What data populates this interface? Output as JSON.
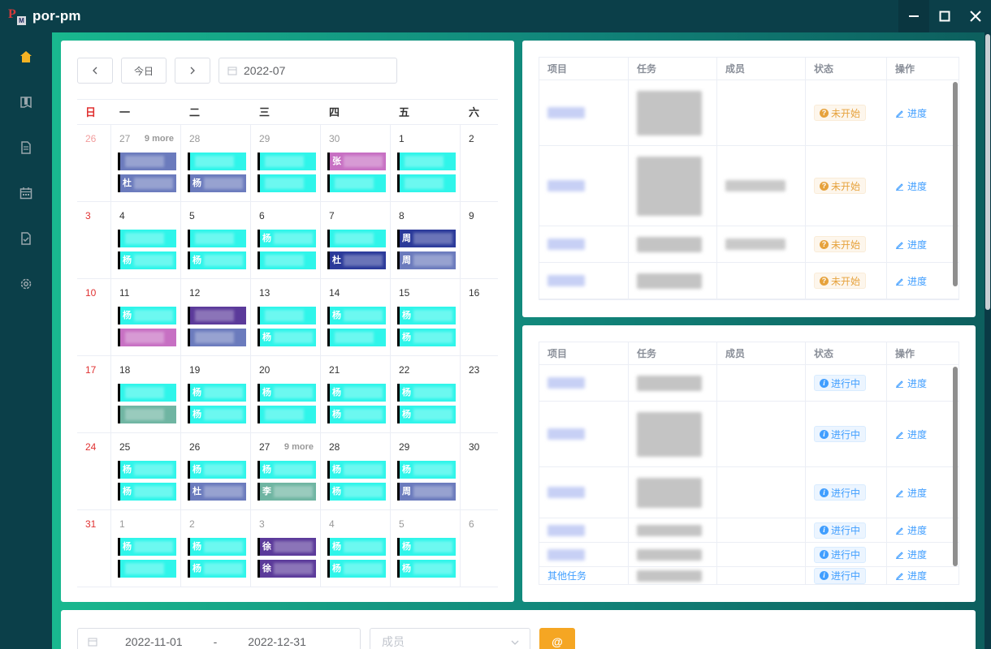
{
  "app": {
    "title": "por-pm"
  },
  "window": {
    "minimize": "—",
    "maximize": "☐",
    "close": "✕"
  },
  "sidebar": {
    "items": [
      "home-icon",
      "book-icon",
      "document-icon",
      "calendar-icon",
      "checklist-icon",
      "settings-icon"
    ]
  },
  "calendar": {
    "prev": "‹",
    "today": "今日",
    "next": "›",
    "month": "2022-07",
    "weekdays": [
      "日",
      "一",
      "二",
      "三",
      "四",
      "五",
      "六"
    ],
    "more_label": "9 more",
    "weeks": [
      [
        "26",
        "27",
        "28",
        "29",
        "30",
        "1",
        "2"
      ],
      [
        "3",
        "4",
        "5",
        "6",
        "7",
        "8",
        "9"
      ],
      [
        "10",
        "11",
        "12",
        "13",
        "14",
        "15",
        "16"
      ],
      [
        "17",
        "18",
        "19",
        "20",
        "21",
        "22",
        "23"
      ],
      [
        "24",
        "25",
        "26",
        "27",
        "28",
        "29",
        "30"
      ],
      [
        "31",
        "1",
        "2",
        "3",
        "4",
        "5",
        "6"
      ]
    ],
    "event_prefixes": {
      "杨": "杨",
      "杜": "杜",
      "周": "周",
      "李": "李",
      "徐": "徐",
      "张": "张"
    }
  },
  "table1": {
    "headers": [
      "项目",
      "任务",
      "成员",
      "状态",
      "操作"
    ],
    "status": "未开始",
    "op": "进度"
  },
  "table2": {
    "headers": [
      "项目",
      "任务",
      "成员",
      "状态",
      "操作"
    ],
    "status": "进行中",
    "op": "进度",
    "last_proj": "其他任务"
  },
  "filter": {
    "start": "2022-11-01",
    "sep": "-",
    "end": "2022-12-31",
    "member_placeholder": "成员",
    "at": "@"
  },
  "colors": {
    "cyan": "#2ff5ea",
    "purple": "#5b3a9a",
    "navy": "#2b3a9a",
    "pink": "#c770c3",
    "teal": "#6fb5a2",
    "slate": "#6b7bbd"
  }
}
